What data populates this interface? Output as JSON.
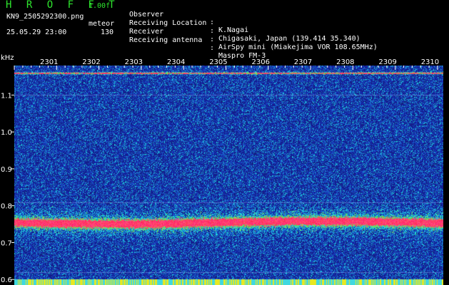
{
  "header": {
    "app_title": "H R O F F T",
    "version": "1.00f",
    "filename": "KN9_2505292300.png",
    "meteor_label": "meteor",
    "datetime": "25.05.29 23:00",
    "count": "130"
  },
  "info": [
    {
      "label": "Observer",
      "value": "K.Nagai"
    },
    {
      "label": "Receiving Location",
      "value": "Chigasaki, Japan (139.414 35.340)"
    },
    {
      "label": "Receiver",
      "value": "AirSpy mini (Miakejima VOR 108.65MHz)"
    },
    {
      "label": "Receiving antenna",
      "value": "Maspro FM-3"
    }
  ],
  "info_separator": ":",
  "spectrogram": {
    "y_unit": "kHz",
    "y_ticks": [
      "1.1",
      "1.0",
      "0.9",
      "0.8",
      "0.7",
      "0.6"
    ],
    "y_range": [
      0.585,
      1.18
    ],
    "time_labels": [
      "2301",
      "2302",
      "2303",
      "2304",
      "2305",
      "2306",
      "2307",
      "2308",
      "2309",
      "2310"
    ],
    "colors": {
      "background": "#000000",
      "noise": "#1a2aa0",
      "signal": "#ff2060",
      "text": "#ffffff",
      "accent": "#2ee62e"
    }
  }
}
